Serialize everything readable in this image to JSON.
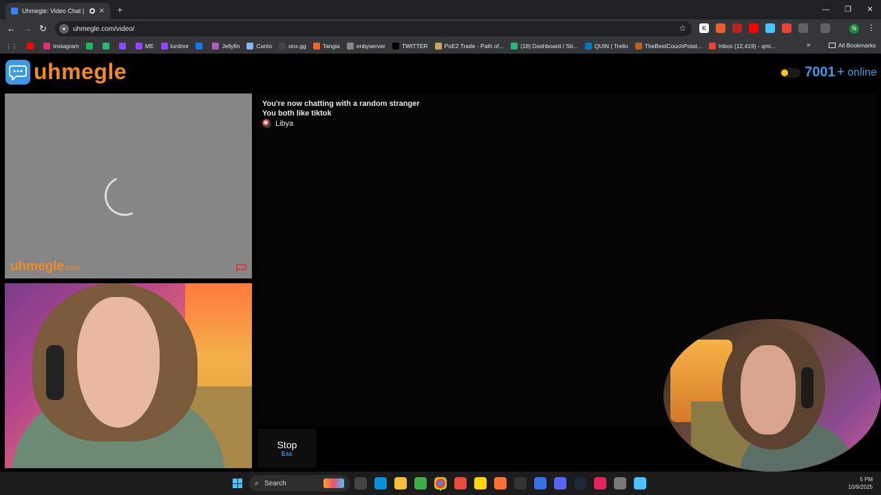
{
  "browser": {
    "tab_title": "Uhmegle: Video Chat | Ome",
    "url": "uhmegle.com/video/",
    "profile_initial": "N",
    "bookmarks": [
      {
        "label": "",
        "color": "#ff0000"
      },
      {
        "label": "Instagram",
        "color": "#e1306c"
      },
      {
        "label": "",
        "color": "#1db954"
      },
      {
        "label": "",
        "color": "#2bb673"
      },
      {
        "label": "",
        "color": "#9146ff"
      },
      {
        "label": "ME",
        "color": "#9146ff"
      },
      {
        "label": "turdnor",
        "color": "#9146ff"
      },
      {
        "label": "",
        "color": "#1877f2"
      },
      {
        "label": "Jellyfin",
        "color": "#aa5cc3"
      },
      {
        "label": "Canto",
        "color": "#8ab4f8"
      },
      {
        "label": "onx.gg",
        "color": "#444444"
      },
      {
        "label": "Tangia",
        "color": "#f26522"
      },
      {
        "label": "enbyserver",
        "color": "#888888"
      },
      {
        "label": "TWITTER",
        "color": "#000000"
      },
      {
        "label": "PoE2 Trade - Path of...",
        "color": "#c8a85a"
      },
      {
        "label": "(18) Dashboard / Str...",
        "color": "#2bb673"
      },
      {
        "label": "QUIN | Trello",
        "color": "#0079bf"
      },
      {
        "label": "TheBestCouchPotat...",
        "color": "#b5651d"
      },
      {
        "label": "Inbox (12,419) - qmi...",
        "color": "#ea4335"
      }
    ],
    "all_bookmarks_label": "All Bookmarks"
  },
  "site": {
    "logo_text": "uhmegle",
    "online_count": "7001",
    "online_plus": "+",
    "online_label": "online",
    "watermark_main": "uhmegle",
    "watermark_tld": ".com",
    "chat": {
      "line1": "You're now chatting with a random stranger",
      "line2": "You both like tiktok",
      "country": "Libya"
    },
    "stop_label": "Stop",
    "stop_key": "Esc"
  },
  "taskbar": {
    "search_label": "Search",
    "time": "5 PM",
    "date": "10/9/2025"
  },
  "colors": {
    "brand_orange": "#f08a24",
    "brand_blue": "#3b9ae8"
  }
}
